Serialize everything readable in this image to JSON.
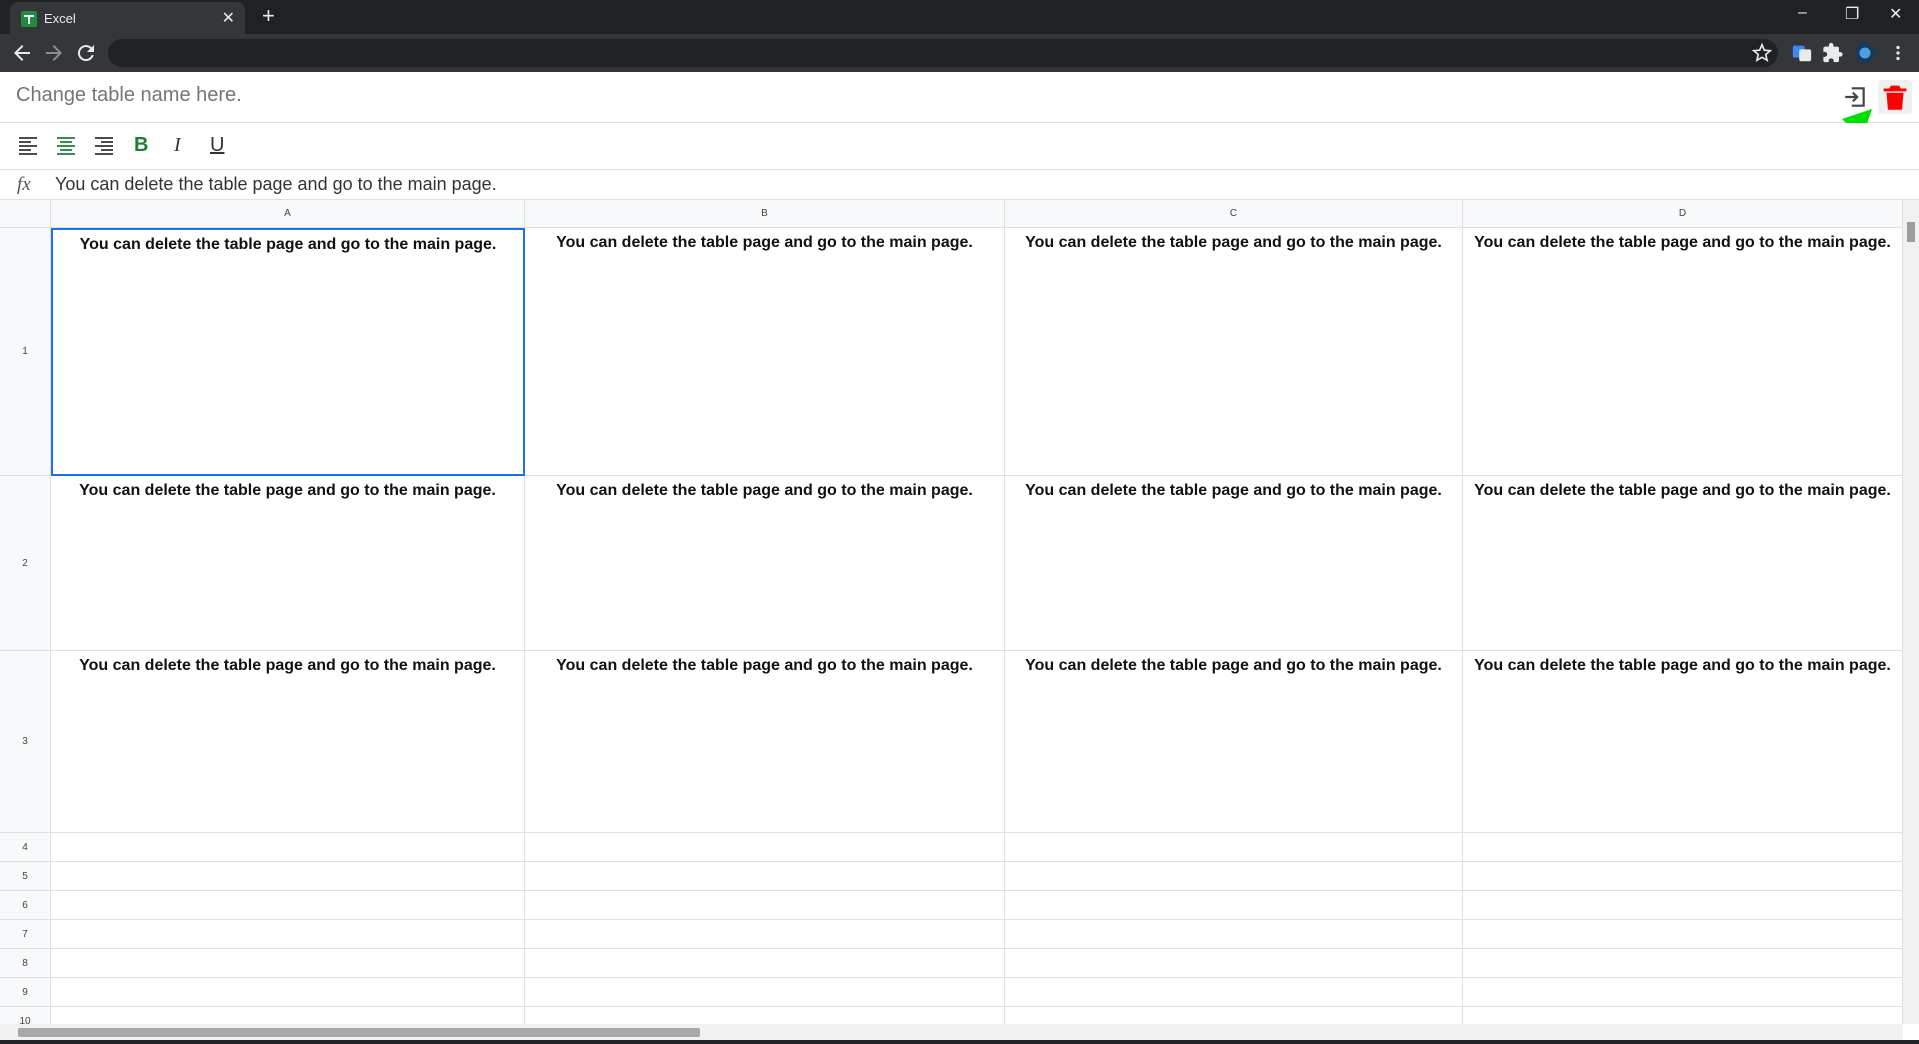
{
  "browser": {
    "tab_title": "Excel",
    "tab_close": "✕",
    "new_tab": "+",
    "minimize": "–",
    "restore": "❐",
    "close": "✕",
    "address": ""
  },
  "app": {
    "table_name_placeholder": "Change table name here.",
    "formula_label": "fx",
    "formula_value": "You can delete the table page and go to the main page.",
    "format_buttons": {
      "bold": "B",
      "italic": "I",
      "underline": "U"
    },
    "delete_color": "#ff0000",
    "annotation_arrow_color": "#00e000"
  },
  "grid": {
    "columns": [
      "A",
      "B",
      "C",
      "D"
    ],
    "rows": [
      "1",
      "2",
      "3",
      "4",
      "5",
      "6",
      "7",
      "8",
      "9",
      "10"
    ],
    "cells": [
      [
        "You can delete the table page and go to the main page.",
        "You can delete the table page and go to the main page.",
        "You can delete the table page and go to the main page.",
        "You can delete the table page and go to the main page."
      ],
      [
        "You can delete the table page and go to the main page.",
        "You can delete the table page and go to the main page.",
        "You can delete the table page and go to the main page.",
        "You can delete the table page and go to the main page."
      ],
      [
        "You can delete the table page and go to the main page.",
        "You can delete the table page and go to the main page.",
        "You can delete the table page and go to the main page.",
        "You can delete the table page and go to the main page."
      ]
    ],
    "selected_cell": "A1"
  }
}
